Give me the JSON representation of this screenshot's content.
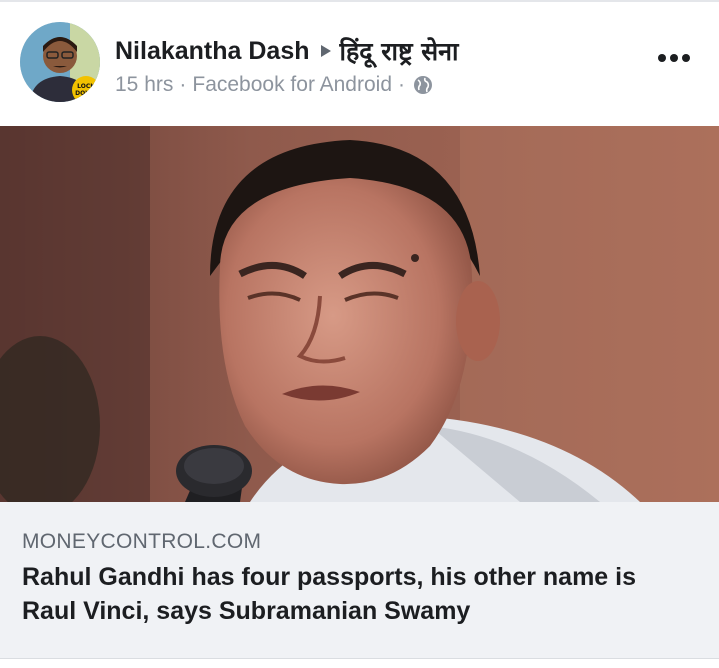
{
  "post": {
    "author": "Nilakantha Dash",
    "group": "हिंदू राष्ट्र सेना",
    "time": "15 hrs",
    "separator": "·",
    "source": "Facebook for Android",
    "privacy_icon": "globe-icon",
    "more_icon": "more-options-icon",
    "avatar_badge": "LOCK DOWN"
  },
  "link": {
    "domain": "MONEYCONTROL.COM",
    "title": "Rahul Gandhi has four passports, his other name is Raul Vinci, says Subramanian Swamy"
  },
  "colors": {
    "text_primary": "#1c1e21",
    "text_secondary": "#8d949e",
    "link_background": "#f0f2f5"
  }
}
